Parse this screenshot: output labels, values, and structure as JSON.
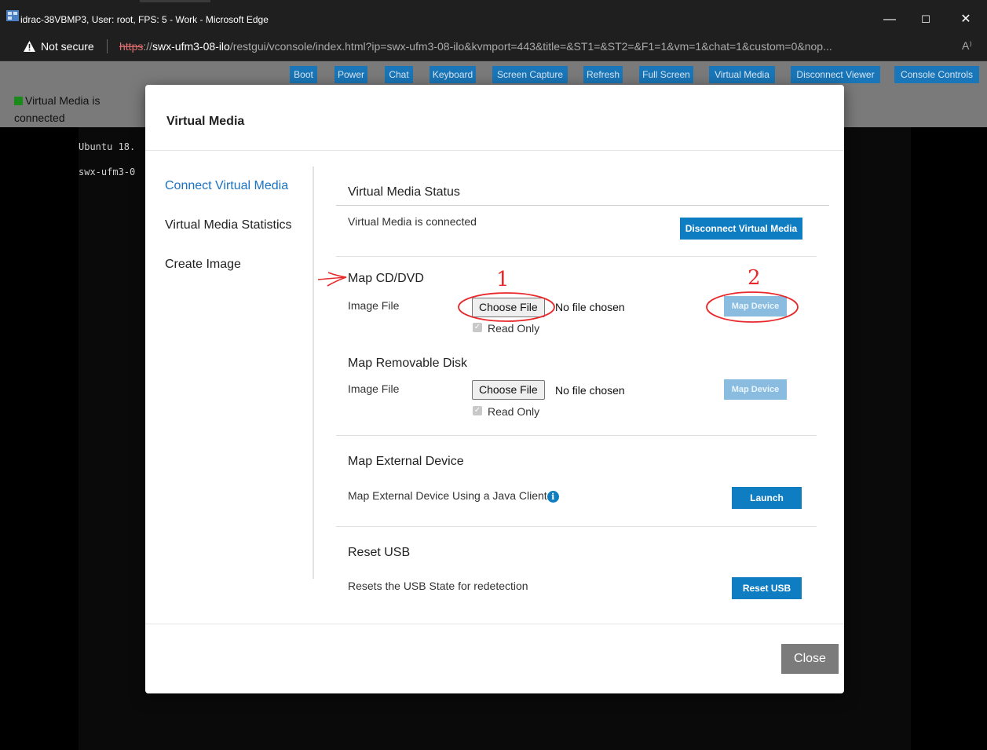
{
  "window": {
    "title": "idrac-38VBMP3, User: root, FPS: 5 - Work - Microsoft Edge",
    "minimize": "—",
    "maximize": "☐",
    "close": "✕"
  },
  "addressbar": {
    "security_label": "Not secure",
    "url_scheme": "https",
    "url_sep": "://",
    "url_host": "swx-ufm3-08-ilo",
    "url_rest": "/restgui/vconsole/index.html?ip=swx-ufm3-08-ilo&kvmport=443&title=&ST1=&ST2=&F1=1&vm=1&chat=1&custom=0&nop...",
    "read_aloud": "A⁾"
  },
  "console_toolbar": {
    "buttons": [
      "Boot",
      "Power",
      "Chat",
      "Keyboard",
      "Screen Capture",
      "Refresh",
      "Full Screen",
      "Virtual Media",
      "Disconnect Viewer",
      "Console Controls"
    ]
  },
  "vm_status": {
    "text_line1": "Virtual Media is",
    "text_line2": "connected",
    "color": "#1a8a1a"
  },
  "terminal": {
    "line1": "Ubuntu 18.",
    "line2": "swx-ufm3-0"
  },
  "modal": {
    "title": "Virtual Media",
    "nav": [
      "Connect Virtual Media",
      "Virtual Media Statistics",
      "Create Image"
    ],
    "status_section": {
      "title": "Virtual Media Status",
      "text": "Virtual Media is connected",
      "button": "Disconnect Virtual Media"
    },
    "cd_section": {
      "title": "Map CD/DVD",
      "image_file_label": "Image File",
      "choose_file": "Choose File",
      "no_file": "No file chosen",
      "read_only": "Read Only",
      "map_button": "Map Device"
    },
    "removable_section": {
      "title": "Map Removable Disk",
      "image_file_label": "Image File",
      "choose_file": "Choose File",
      "no_file": "No file chosen",
      "read_only": "Read Only",
      "map_button": "Map Device"
    },
    "external_section": {
      "title": "Map External Device",
      "text": "Map External Device Using a Java Client",
      "info_icon": "i",
      "button": "Launch"
    },
    "reset_section": {
      "title": "Reset USB",
      "text": "Resets the USB State for redetection",
      "button": "Reset USB"
    },
    "close_button": "Close"
  },
  "annotations": {
    "label_1": "1",
    "label_2": "2",
    "color": "#e8282a"
  },
  "colors": {
    "accent": "#0f7dc2",
    "disabled_button": "#89bcdf",
    "active_nav": "#1a73c1"
  }
}
